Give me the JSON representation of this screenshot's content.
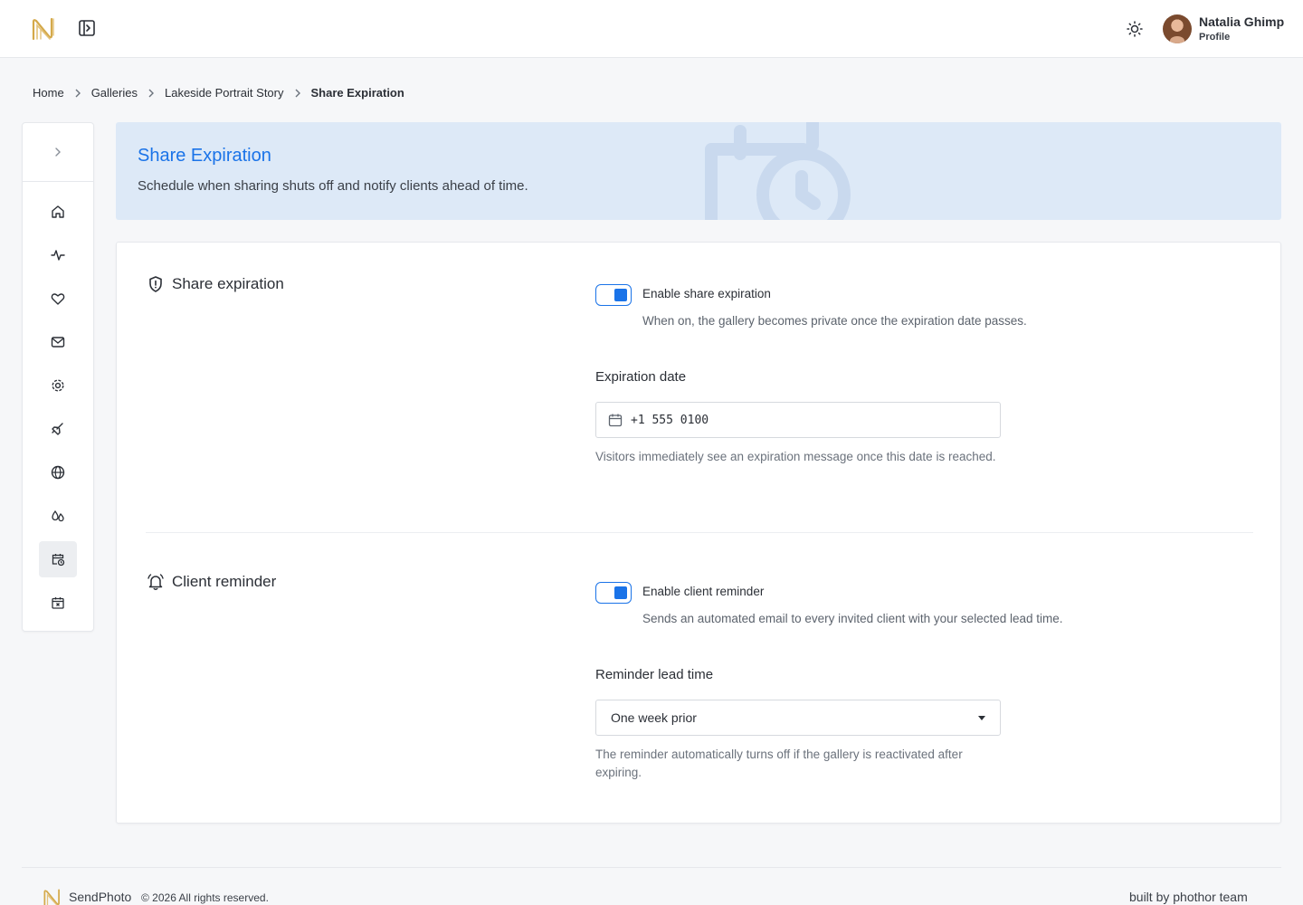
{
  "header": {
    "logo_icon": "brand-logo",
    "sidebar_toggle_icon": "panel-toggle-icon",
    "theme_icon": "sun-icon",
    "user": {
      "name": "Natalia Ghimp",
      "role": "Profile"
    }
  },
  "breadcrumb": [
    "Home",
    "Galleries",
    "Lakeside Portrait Story",
    "Share Expiration"
  ],
  "sidebar": {
    "expand_icon": "chevron-right-icon",
    "items": [
      {
        "icon": "home-icon"
      },
      {
        "icon": "activity-icon"
      },
      {
        "icon": "heart-icon"
      },
      {
        "icon": "mail-icon"
      },
      {
        "icon": "settings-icon"
      },
      {
        "icon": "brush-icon"
      },
      {
        "icon": "globe-icon"
      },
      {
        "icon": "droplets-icon"
      },
      {
        "icon": "calendar-clock-icon",
        "active": true
      },
      {
        "icon": "calendar-x-icon"
      }
    ]
  },
  "hero": {
    "title": "Share Expiration",
    "subtitle": "Schedule when sharing shuts off and notify clients ahead of time."
  },
  "share_expiration": {
    "title": "Share expiration",
    "toggle_label": "Enable share expiration",
    "toggle_on": true,
    "toggle_desc": "When on, the gallery becomes private once the expiration date passes.",
    "date_label": "Expiration date",
    "date_value": "+1 555 0100",
    "date_help": "Visitors immediately see an expiration message once this date is reached."
  },
  "client_reminder": {
    "title": "Client reminder",
    "toggle_label": "Enable client reminder",
    "toggle_on": true,
    "toggle_desc": "Sends an automated email to every invited client with your selected lead time.",
    "lead_label": "Reminder lead time",
    "lead_value": "One week prior",
    "lead_help": "The reminder automatically turns off if the gallery is reactivated after expiring."
  },
  "footer": {
    "brand": "SendPhoto",
    "copyright": "© 2026 All rights reserved.",
    "credit": "built by phothor team"
  },
  "colors": {
    "accent": "#1a73e8",
    "hero_bg": "#dde9f7",
    "logo_gold": "#d4a94a"
  }
}
